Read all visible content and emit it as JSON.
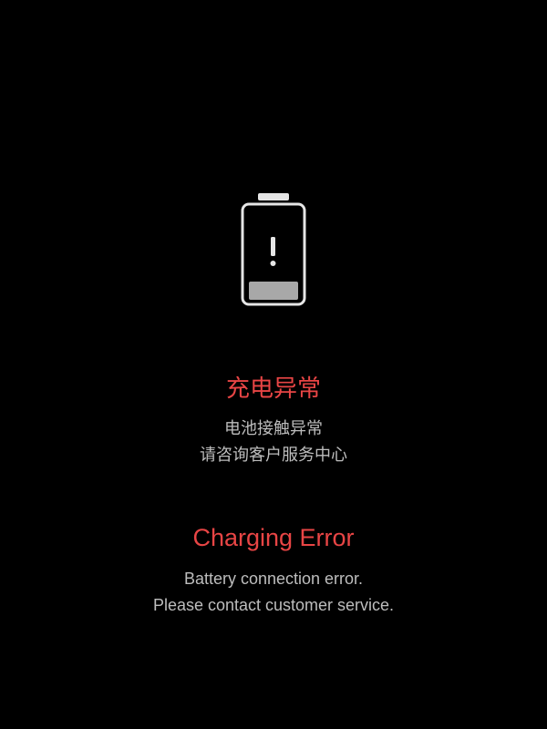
{
  "colors": {
    "background": "#000000",
    "title": "#E84545",
    "message": "#BDBDBD",
    "battery_outline": "#E6E6E6",
    "battery_fill": "#A8A8A8"
  },
  "battery": {
    "icon": "battery-warning-icon"
  },
  "chinese": {
    "title": "充电异常",
    "line1": "电池接触异常",
    "line2": "请咨询客户服务中心"
  },
  "english": {
    "title": "Charging Error",
    "line1": "Battery connection error.",
    "line2": "Please contact customer service."
  }
}
